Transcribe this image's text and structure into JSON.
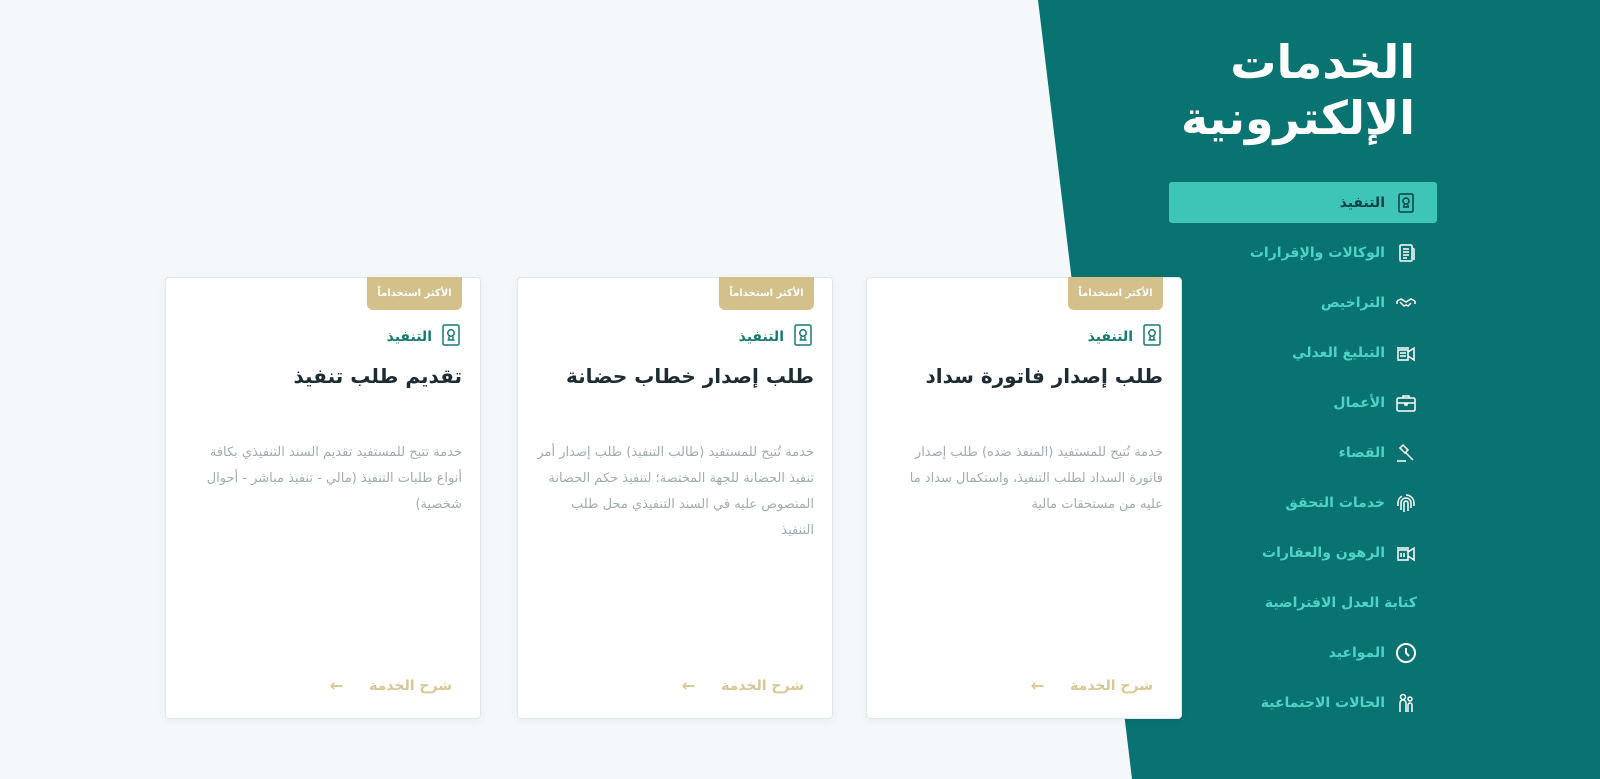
{
  "panel": {
    "title_line1": "الخدمات",
    "title_line2": "الإلكترونية"
  },
  "nav": [
    {
      "label": "التنفيذ",
      "icon": "document-stamp-icon",
      "active": true
    },
    {
      "label": "الوكالات والإقرارات",
      "icon": "document-list-icon"
    },
    {
      "label": "التراخيص",
      "icon": "handshake-icon"
    },
    {
      "label": "التبليغ العدلي",
      "icon": "megaphone-icon"
    },
    {
      "label": "الأعمال",
      "icon": "briefcase-icon"
    },
    {
      "label": "القضاء",
      "icon": "gavel-icon"
    },
    {
      "label": "خدمات التحقق",
      "icon": "fingerprint-icon"
    },
    {
      "label": "الرهون والعقارات",
      "icon": "building-icon"
    },
    {
      "label": "كتابة العدل الافتراضية",
      "icon": ""
    },
    {
      "label": "المواعيد",
      "icon": "clock-icon"
    },
    {
      "label": "الحالات الاجتماعية",
      "icon": "family-icon"
    }
  ],
  "cards": [
    {
      "badge": "الأكثر استخداماً",
      "category": "التنفيذ",
      "title": "طلب إصدار فاتورة سداد",
      "description": "خدمة تُتيح للمستفيد (المنفذ ضده) طلب إصدار فاتورة السداد لطلب التنفيذ، واستكمال سداد ما عليه من مستحقات مالية",
      "link": "شرح الخدمة"
    },
    {
      "badge": "الأكثر استخداماً",
      "category": "التنفيذ",
      "title": "طلب إصدار خطاب حضانة",
      "description": "خدمة تُتيح للمستفيد (طالب التنفيذ) طلب إصدار أمر تنفيذ الحضانة للجهة المختصة؛ لتنفيذ حكم الحضانة المنصوص عليه في السند التنفيذي محل طلب التنفيذ",
      "link": "شرح الخدمة"
    },
    {
      "badge": "الأكثر استخداماً",
      "category": "التنفيذ",
      "title": "تقديم طلب تنفيذ",
      "description": "خدمة تتيح للمستفيد تقديم السند التنفيذي بكافة أنواع طلبات التنفيذ (مالي - تنفيذ مباشر - أحوال شخصية)",
      "link": "شرح الخدمة"
    }
  ],
  "colors": {
    "panel_teal": "#087370",
    "active_item": "#3ec5b8",
    "nav_text": "#4fd3c5",
    "badge_gold": "#d4c08a"
  }
}
